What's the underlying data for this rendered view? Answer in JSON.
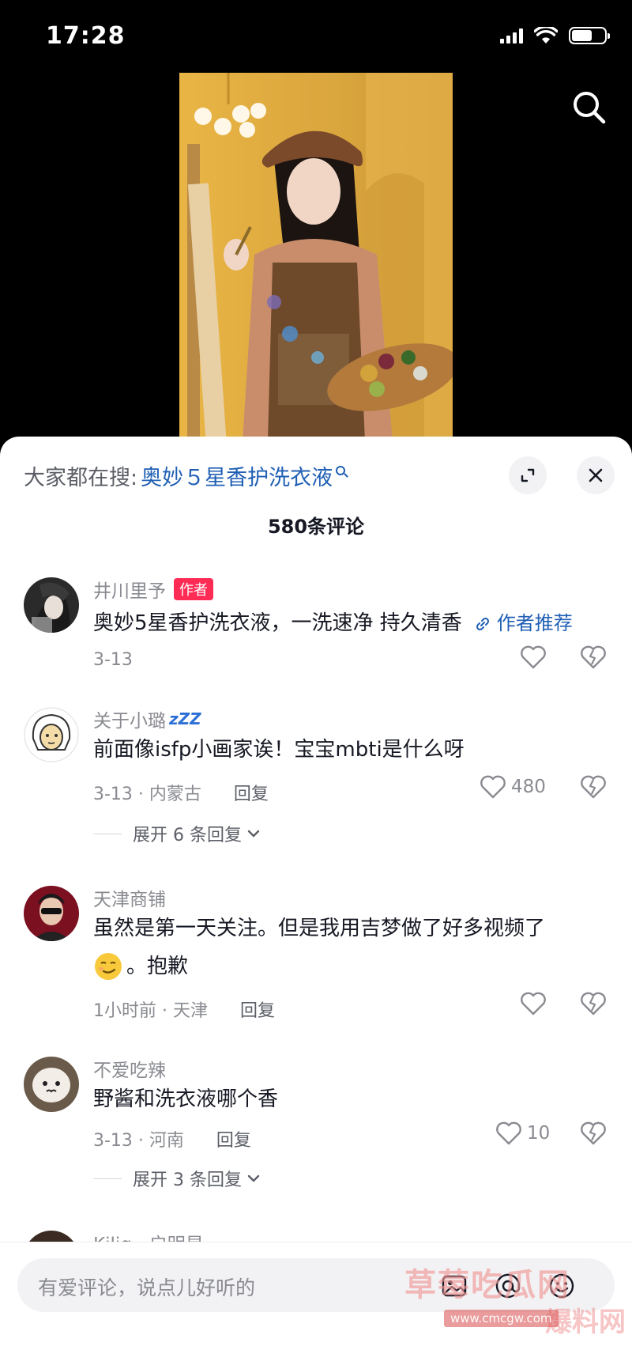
{
  "status_bar": {
    "time": "17:28"
  },
  "video": {
    "description": ""
  },
  "sheet": {
    "trending_prefix": "大家都在搜:",
    "trending_keyword": "奥妙５星香护洗衣液",
    "comment_count": "580条评论"
  },
  "comments": [
    {
      "username": "井川里予",
      "badge": "作者",
      "text": "奥妙5星香护洗衣液，一洗速净 持久清香",
      "link_label": "作者推荐",
      "meta": "3-13",
      "reply_label": "",
      "likes": ""
    },
    {
      "username": "关于小璐",
      "zzz": "zZZ",
      "text": "前面像isfp小画家诶！宝宝mbti是什么呀",
      "meta": "3-13 · 内蒙古",
      "reply_label": "回复",
      "likes": "480",
      "expand_label": "展开 6 条回复"
    },
    {
      "username": "天津商铺",
      "text": "虽然是第一天关注。但是我用吉梦做了好多视频了",
      "text_line2": "。抱歉",
      "meta": "1小时前 · 天津",
      "reply_label": "回复",
      "likes": ""
    },
    {
      "username": "不爱吃辣",
      "text": "野酱和洗衣液哪个香",
      "meta": "3-13 · 河南",
      "reply_label": "回复",
      "likes": "10",
      "expand_label": "展开 3 条回复"
    },
    {
      "username": "Kiliq · 启明星"
    }
  ],
  "input": {
    "placeholder": "有爱评论，说点儿好听的"
  },
  "watermark": {
    "title": "草莓吃瓜网",
    "url": "www.cmcgw.com",
    "sub": "爆料网"
  },
  "colors": {
    "accent": "#fe2c55",
    "link": "#1f5fb4",
    "text": "#161823",
    "muted": "#8a8b91"
  }
}
